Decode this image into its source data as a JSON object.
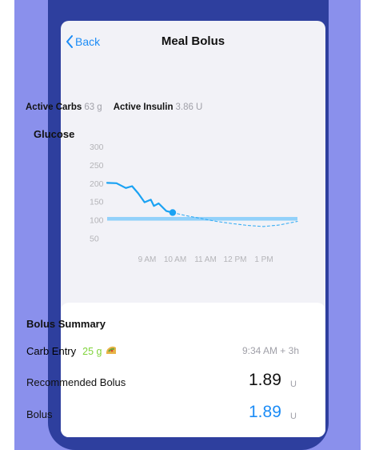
{
  "navbar": {
    "back_label": "Back",
    "title": "Meal Bolus"
  },
  "active": {
    "carbs_label": "Active Carbs",
    "carbs_value": "63 g",
    "insulin_label": "Active Insulin",
    "insulin_value": "3.86 U"
  },
  "chart_data": {
    "type": "line",
    "title": "Glucose",
    "x_tick_labels": [
      "9 AM",
      "10 AM",
      "11 AM",
      "12 PM",
      "1 PM"
    ],
    "y_ticks": [
      300,
      250,
      200,
      150,
      100,
      50
    ],
    "ylim": [
      25,
      300
    ],
    "xlim": [
      7.5,
      13.6
    ],
    "grid": false,
    "target_range": [
      98,
      108
    ],
    "series": [
      {
        "style": "history",
        "x": [
          7.5,
          7.8,
          8.1,
          8.3,
          8.5,
          8.7,
          8.9,
          9.0,
          9.15,
          9.4,
          9.6
        ],
        "values": [
          201,
          200,
          187,
          192,
          172,
          148,
          155,
          138,
          145,
          124,
          120
        ]
      },
      {
        "style": "forecast",
        "x": [
          9.6,
          10.0,
          10.5,
          11.0,
          11.5,
          12.0,
          12.5,
          13.0,
          13.6
        ],
        "values": [
          120,
          112,
          104,
          96,
          90,
          85,
          82,
          86,
          96
        ]
      }
    ],
    "current_point": {
      "x": 9.6,
      "value": 120
    },
    "colors": {
      "line": "#1aa2f3",
      "target": "#87cdfa",
      "axis_text": "#b4b4b8"
    }
  },
  "summary": {
    "title": "Bolus Summary",
    "carb_entry_label": "Carb Entry",
    "carb_grams": "25 g",
    "carb_icon": "taco-icon",
    "carb_time": "9:34 AM + 3h",
    "recommended_label": "Recommended Bolus",
    "recommended_value": "1.89",
    "recommended_unit": "U",
    "bolus_label": "Bolus",
    "bolus_value": "1.89",
    "bolus_unit": "U"
  },
  "colors": {
    "accent": "#1c8cf6",
    "carb_green": "#7fd33a",
    "bolus_blue": "#1c8cf6"
  }
}
